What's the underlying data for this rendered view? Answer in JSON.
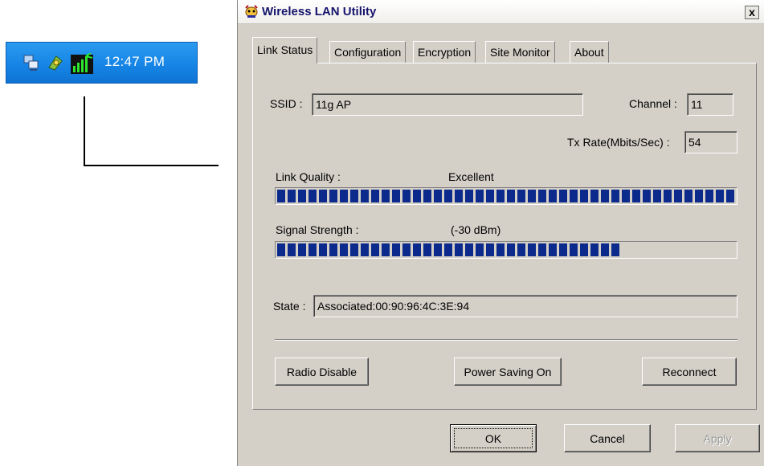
{
  "tray": {
    "icons": [
      "network-icon",
      "wireless-utility-icon",
      "signal-strength-icon"
    ],
    "clock": "12:47 PM",
    "colors": {
      "background": "#1685e6",
      "clock_text": "#ffffff"
    }
  },
  "window": {
    "title": "Wireless LAN Utility",
    "close_label": "x"
  },
  "tabs": [
    {
      "label": "Link Status",
      "active": true
    },
    {
      "label": "Configuration",
      "active": false
    },
    {
      "label": "Encryption",
      "active": false
    },
    {
      "label": "Site Monitor",
      "active": false
    },
    {
      "label": "About",
      "active": false
    }
  ],
  "link_status": {
    "ssid_label": "SSID :",
    "ssid_value": "11g AP",
    "channel_label": "Channel :",
    "channel_value": "11",
    "tx_rate_label": "Tx Rate(Mbits/Sec) :",
    "tx_rate_value": "54",
    "link_quality_label": "Link Quality :",
    "link_quality_value": "Excellent",
    "link_quality_percent": 100,
    "signal_strength_label": "Signal Strength :",
    "signal_strength_value": "(-30 dBm)",
    "signal_strength_percent": 75,
    "state_label": "State :",
    "state_value": "Associated:00:90:96:4C:3E:94"
  },
  "buttons": {
    "radio_disable": "Radio Disable",
    "power_saving": "Power Saving On",
    "reconnect": "Reconnect",
    "ok": "OK",
    "cancel": "Cancel",
    "apply": "Apply"
  },
  "colors": {
    "bar_fill": "#0b2a8c",
    "face": "#d4d0c8",
    "title_text": "#15146b"
  }
}
